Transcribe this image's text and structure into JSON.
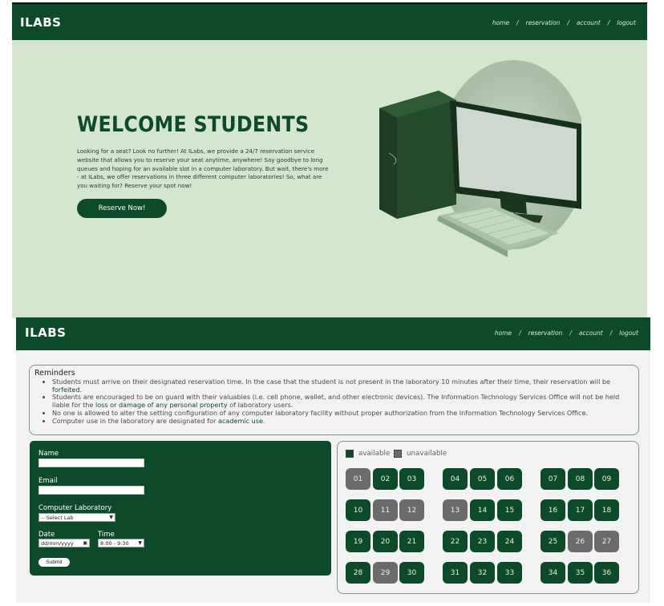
{
  "brand": "ILABS",
  "nav": [
    "home",
    "reservation",
    "account",
    "logout"
  ],
  "hero": {
    "title": "WELCOME STUDENTS",
    "text": "Looking for a seat? Look no further! At ILabs, we provide a 24/7 reservation service website that allows you to reserve your seat anytime, anywhere! Say goodbye to long queues and hoping for an available slot in a computer laboratory. But wait, there's more - at ILabs, we offer reservations in three different computer laboratories! So, what are you waiting for? Reserve your spot now!",
    "button": "Reserve Now!"
  },
  "reminders": {
    "title": "Reminders",
    "items": [
      {
        "pre": "Students must arrive on their designated reservation time. In the case that the student is not present in the laboratory 10 minutes after their time, their reservation will be ",
        "em": "forfeited",
        "post": "."
      },
      {
        "pre": "Students are encouraged to be on guard with their valuables (i.e. cell phone, wallet, and other electronic devices). The Information Technology Services Office will not be held liable for the ",
        "em": "loss or damage of any personal property",
        "post": " of laboratory users."
      },
      {
        "pre": "No one is allowed to alter the setting configuration of any computer laboratory facility without proper authorization from the Information Technology Services Office.",
        "em": "",
        "post": ""
      },
      {
        "pre": "Computer use in the laboratory are designated for ",
        "em": "academic use",
        "post": "."
      }
    ]
  },
  "form": {
    "name_label": "Name",
    "email_label": "Email",
    "lab_label": "Computer Laboratory",
    "lab_selected": "-- Select Lab",
    "date_label": "Date",
    "date_placeholder": "dd/mm/yyyy",
    "time_label": "Time",
    "time_selected": "8:00 - 9:30",
    "submit": "Submit"
  },
  "legend": {
    "available": "available",
    "unavailable": "unavailable"
  },
  "colors": {
    "available": "#0d4a2a",
    "unavailable": "#6b6b6b",
    "accent": "#0d4a2a",
    "hero_bg": "#d4e6d0"
  },
  "seats": [
    {
      "n": "01",
      "s": "un"
    },
    {
      "n": "02",
      "s": "av"
    },
    {
      "n": "03",
      "s": "av"
    },
    {
      "n": "04",
      "s": "av"
    },
    {
      "n": "05",
      "s": "av"
    },
    {
      "n": "06",
      "s": "av"
    },
    {
      "n": "07",
      "s": "av"
    },
    {
      "n": "08",
      "s": "av"
    },
    {
      "n": "09",
      "s": "av"
    },
    {
      "n": "10",
      "s": "av"
    },
    {
      "n": "11",
      "s": "un"
    },
    {
      "n": "12",
      "s": "un"
    },
    {
      "n": "13",
      "s": "un"
    },
    {
      "n": "14",
      "s": "av"
    },
    {
      "n": "15",
      "s": "av"
    },
    {
      "n": "16",
      "s": "av"
    },
    {
      "n": "17",
      "s": "av"
    },
    {
      "n": "18",
      "s": "av"
    },
    {
      "n": "19",
      "s": "av"
    },
    {
      "n": "20",
      "s": "av"
    },
    {
      "n": "21",
      "s": "av"
    },
    {
      "n": "22",
      "s": "av"
    },
    {
      "n": "23",
      "s": "av"
    },
    {
      "n": "24",
      "s": "av"
    },
    {
      "n": "25",
      "s": "av"
    },
    {
      "n": "26",
      "s": "un"
    },
    {
      "n": "27",
      "s": "un"
    },
    {
      "n": "28",
      "s": "av"
    },
    {
      "n": "29",
      "s": "un"
    },
    {
      "n": "30",
      "s": "av"
    },
    {
      "n": "31",
      "s": "av"
    },
    {
      "n": "32",
      "s": "av"
    },
    {
      "n": "33",
      "s": "av"
    },
    {
      "n": "34",
      "s": "av"
    },
    {
      "n": "35",
      "s": "av"
    },
    {
      "n": "36",
      "s": "av"
    }
  ]
}
